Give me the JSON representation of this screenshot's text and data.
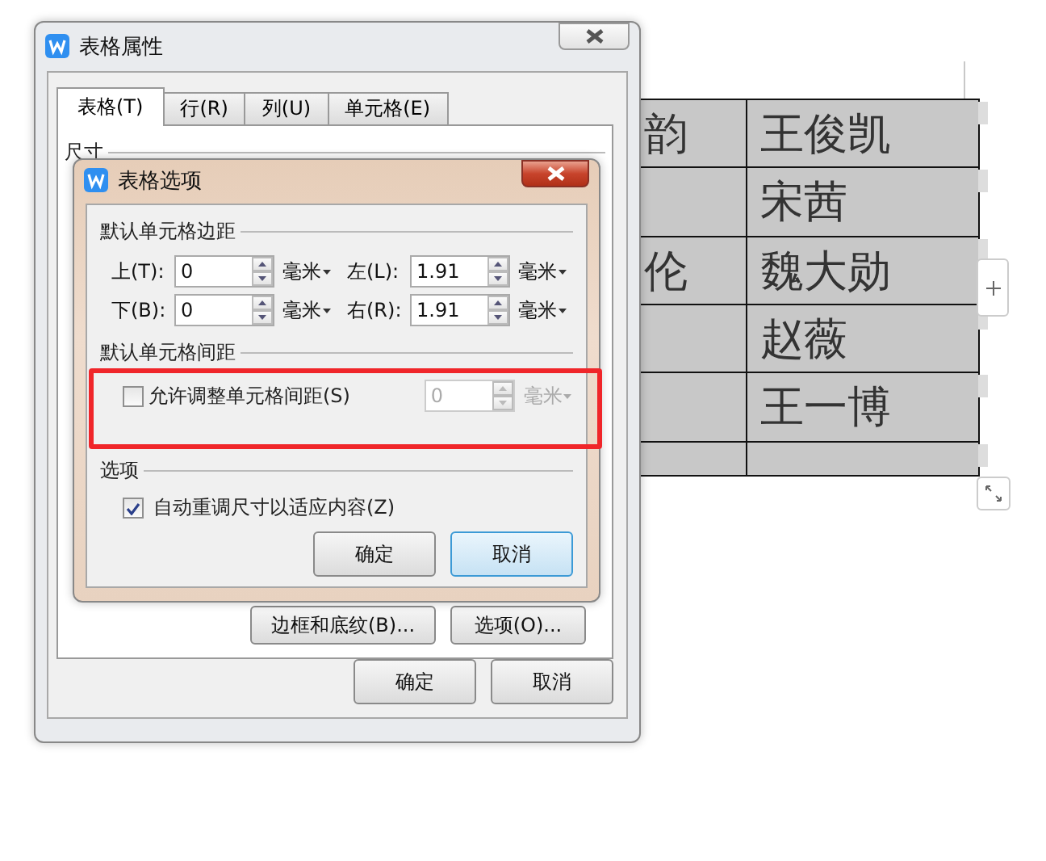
{
  "document_table": {
    "rows": [
      {
        "col_1": "韵",
        "col_2": "王俊凯"
      },
      {
        "col_2": "宋茜"
      },
      {
        "col_1": "伦",
        "col_2": "魏大勋"
      },
      {
        "col_2": "赵薇"
      },
      {
        "col_2": "王一博"
      },
      {}
    ]
  },
  "table_properties_dialog": {
    "title": "表格属性",
    "tabs": [
      {
        "label": "表格(T)",
        "selected": true
      },
      {
        "label": "行(R)",
        "selected": false
      },
      {
        "label": "列(U)",
        "selected": false
      },
      {
        "label": "单元格(E)",
        "selected": false
      }
    ],
    "group_label": "尺寸",
    "panel_buttons": [
      "边框和底纹(B)...",
      "选项(O)..."
    ],
    "buttons": [
      {
        "label": "确定",
        "focused": false
      },
      {
        "label": "取消",
        "focused": false
      }
    ]
  },
  "table_options_dialog": {
    "title": "表格选项",
    "margins_group": "默认单元格边距",
    "margins": [
      {
        "label": "上(T):",
        "value": "0",
        "unit": "毫米"
      },
      {
        "label": "左(L):",
        "value": "1.91",
        "unit": "毫米"
      },
      {
        "label": "下(B):",
        "value": "0",
        "unit": "毫米"
      },
      {
        "label": "右(R):",
        "value": "1.91",
        "unit": "毫米"
      }
    ],
    "spacing_group": "默认单元格间距",
    "spacing": {
      "label": "允许调整单元格间距(S)",
      "checked": false,
      "value": "0",
      "unit": "毫米",
      "disabled": true
    },
    "options_group": "选项",
    "options": [
      {
        "label": "自动重调尺寸以适应内容(Z)",
        "checked": true
      }
    ],
    "buttons": [
      {
        "label": "确定",
        "focused": false
      },
      {
        "label": "取消",
        "focused": true
      }
    ]
  }
}
